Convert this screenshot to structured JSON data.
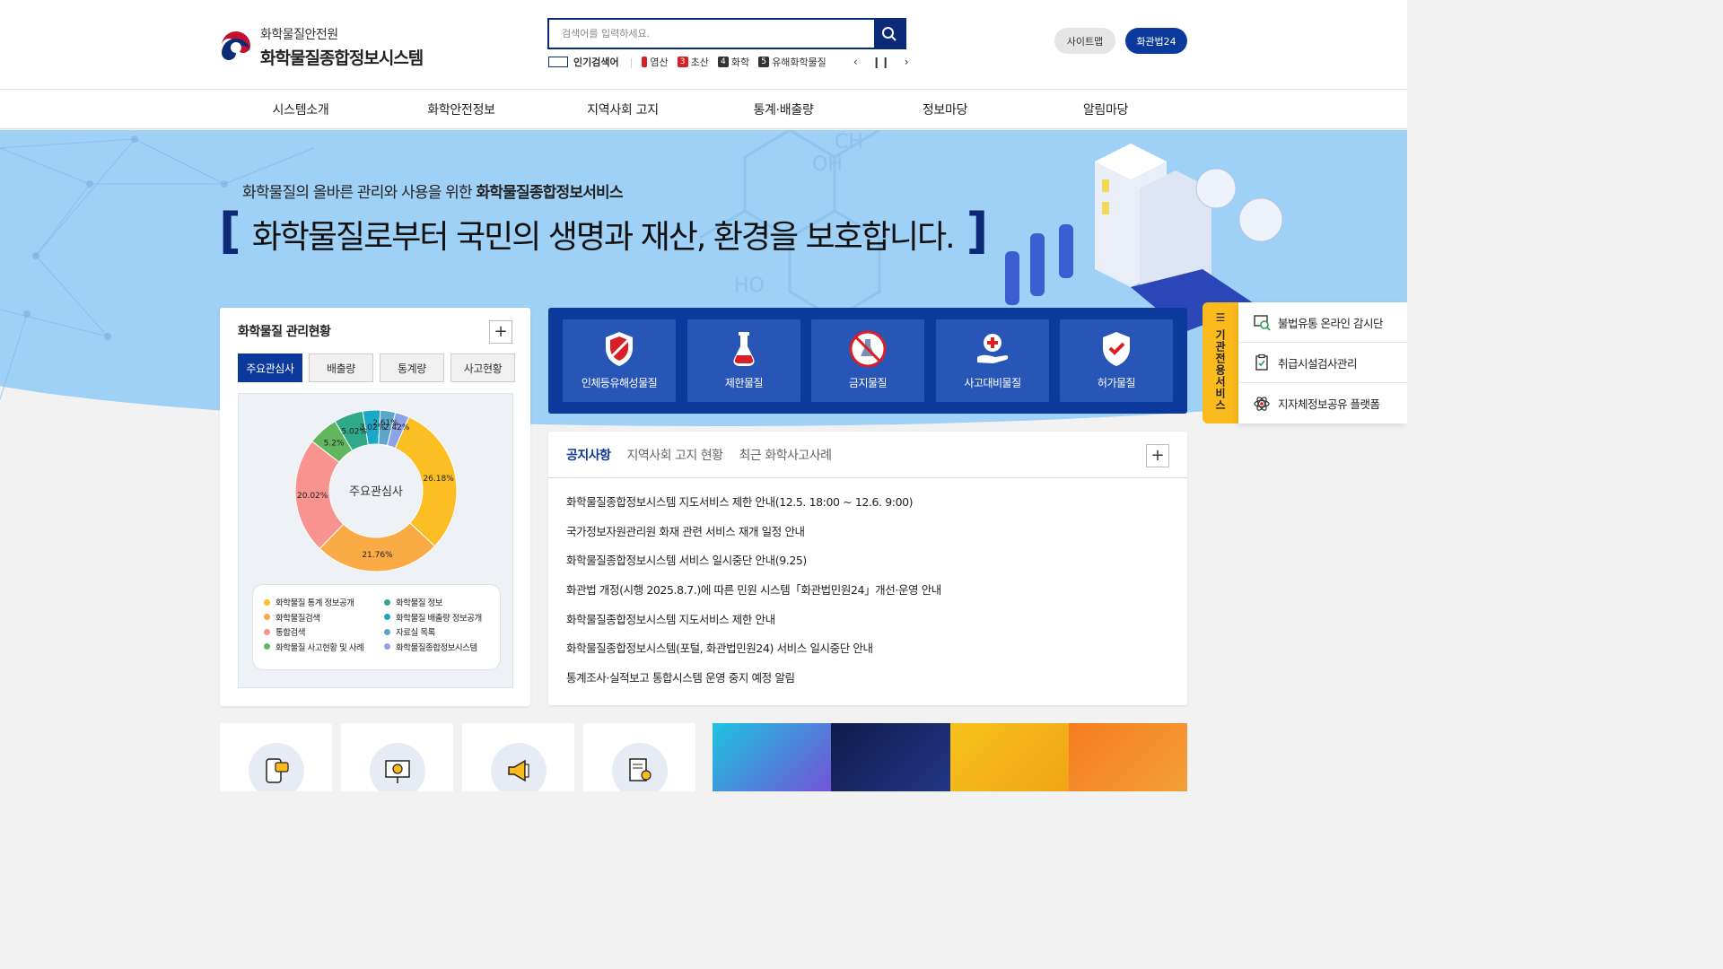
{
  "header": {
    "org_name": "화학물질안전원",
    "system_name": "화학물질종합정보시스템",
    "search_placeholder": "검색어를 입력하세요.",
    "popular_label": "인기검색어",
    "popular_keywords": [
      {
        "rank": "",
        "text": "염산"
      },
      {
        "rank": "3",
        "text": "초산"
      },
      {
        "rank": "4",
        "text": "화학"
      },
      {
        "rank": "5",
        "text": "유해화학물질"
      }
    ],
    "prev_label": "‹",
    "pause_label": "❙❙",
    "next_label": "›",
    "sitemap_label": "사이트맵",
    "law24_label": "화관법24"
  },
  "gnb": [
    "시스템소개",
    "화학안전정보",
    "지역사회 고지",
    "통계·배출량",
    "정보마당",
    "알림마당"
  ],
  "hero": {
    "subtitle_prefix": "화학물질의 올바른 관리와 사용을 위한 ",
    "subtitle_bold": "화학물질종합정보서비스",
    "title": "화학물질로부터 국민의 생명과 재산, 환경을 보호합니다.",
    "bracket_open": "[",
    "bracket_close": "]"
  },
  "status_panel": {
    "title": "화학물질 관리현황",
    "plus_label": "+",
    "tabs": [
      "주요관심사",
      "배출량",
      "통계량",
      "사고현황"
    ],
    "active_tab": 0,
    "chart_center_label": "주요관심사"
  },
  "chart_data": {
    "type": "pie",
    "title": "",
    "center_label": "주요관심사",
    "slices": [
      {
        "name": "화학물질 통계 정보공개",
        "value": 26.18,
        "label": "26.18%",
        "color": "#fbbf23"
      },
      {
        "name": "화학물질검색",
        "value": 21.76,
        "label": "21.76%",
        "color": "#fbab45"
      },
      {
        "name": "통합검색",
        "value": 20.02,
        "label": "20.02%",
        "color": "#f9938f"
      },
      {
        "name": "화학물질 사고현황 및 사례",
        "value": 5.2,
        "label": "5.2%",
        "color": "#62b660"
      },
      {
        "name": "화학물질 정보",
        "value": 5.02,
        "label": "5.02%",
        "color": "#2fa988"
      },
      {
        "name": "화학물질 배출량 정보공개",
        "value": 3.02,
        "label": "3.02%",
        "color": "#19a9c7"
      },
      {
        "name": "자료실 목록",
        "value": 2.61,
        "label": "2.61%",
        "color": "#5aa6c9"
      },
      {
        "name": "화학물질종합정보시스템",
        "value": 2.42,
        "label": "2.42%",
        "color": "#8da3e8"
      }
    ],
    "legend": [
      "화학물질 통계 정보공개",
      "화학물질 정보",
      "화학물질검색",
      "화학물질 배출량 정보공개",
      "통합검색",
      "자료실 목록",
      "화학물질 사고현황 및 사례",
      "화학물질종합정보시스템"
    ],
    "legend_colors": [
      "#fbbf23",
      "#2fa988",
      "#fbab45",
      "#19a9c7",
      "#f9938f",
      "#5aa6c9",
      "#62b660",
      "#8da3e8"
    ]
  },
  "quick_menu": [
    {
      "label": "인체등유해성물질",
      "icon": "shield-slash-icon"
    },
    {
      "label": "제한물질",
      "icon": "test-tube-icon"
    },
    {
      "label": "금지물질",
      "icon": "prohibited-flask-icon"
    },
    {
      "label": "사고대비물질",
      "icon": "hand-cross-icon"
    },
    {
      "label": "허가물질",
      "icon": "shield-check-icon"
    }
  ],
  "notice": {
    "tabs": [
      "공지사항",
      "지역사회 고지 현황",
      "최근 화학사고사례"
    ],
    "active_tab": 0,
    "plus_label": "+",
    "items": [
      "화학물질종합정보시스템 지도서비스 제한 안내(12.5. 18:00 ~ 12.6. 9:00)",
      "국가정보자원관리원 화재 관련 서비스 재개 일정 안내",
      "화학물질종합정보시스템 서비스 일시중단 안내(9.25)",
      "화관법 개정(시행 2025.8.7.)에 따른 민원 시스템「화관법민원24」개선·운영 안내",
      "화학물질종합정보시스템 지도서비스 제한 안내",
      "화학물질종합정보시스템(포털, 화관법민원24) 서비스 일시중단 안내",
      "통계조사·실적보고 통합시스템 운영 중지 예정 알림"
    ]
  },
  "side_service": {
    "tab_label": "기관전용서비스",
    "menu_icon": "☰",
    "items": [
      {
        "label": "불법유통 온라인 감시단",
        "icon": "monitor-search-icon"
      },
      {
        "label": "취급시설검사관리",
        "icon": "clipboard-check-icon"
      },
      {
        "label": "지자체정보공유 플랫폼",
        "icon": "atom-icon"
      }
    ]
  },
  "bottom_cards": [
    {
      "icon": "phone-chat-icon"
    },
    {
      "icon": "presentation-chart-icon"
    },
    {
      "icon": "megaphone-icon"
    },
    {
      "icon": "document-key-icon"
    }
  ],
  "colors": {
    "primary": "#0b3a9c",
    "navy": "#0b2a78",
    "quick_item": "#2856b7",
    "accent_yellow": "#fcbb1d",
    "hero_sky": "#9fd0f5"
  }
}
